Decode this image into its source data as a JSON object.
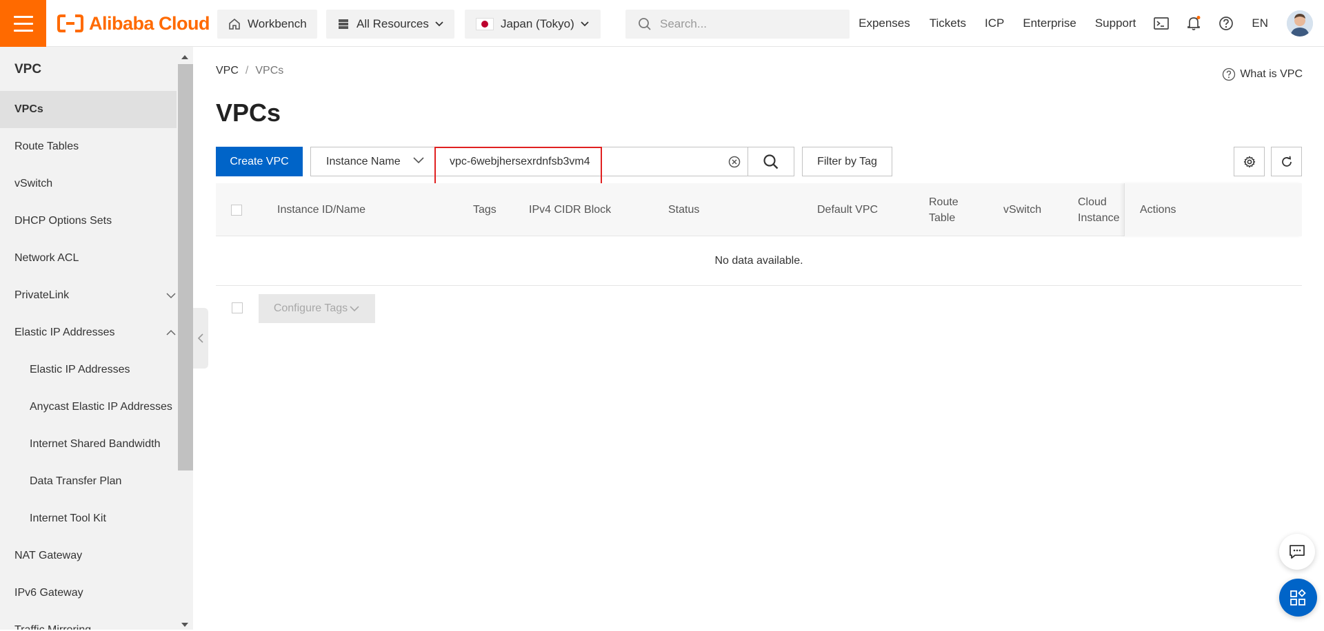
{
  "header": {
    "brand": "Alibaba Cloud",
    "workbench": "Workbench",
    "resources": "All Resources",
    "region": "Japan (Tokyo)",
    "search_placeholder": "Search...",
    "links": [
      "Expenses",
      "Tickets",
      "ICP",
      "Enterprise",
      "Support"
    ],
    "lang": "EN"
  },
  "sidebar": {
    "title": "VPC",
    "items": [
      {
        "label": "VPCs",
        "active": true
      },
      {
        "label": "Route Tables"
      },
      {
        "label": "vSwitch"
      },
      {
        "label": "DHCP Options Sets"
      },
      {
        "label": "Network ACL"
      },
      {
        "label": "PrivateLink",
        "expand": "down"
      },
      {
        "label": "Elastic IP Addresses",
        "expand": "up"
      },
      {
        "label": "Elastic IP Addresses",
        "sub": true
      },
      {
        "label": "Anycast Elastic IP Addresses",
        "sub": true
      },
      {
        "label": "Internet Shared Bandwidth",
        "sub": true
      },
      {
        "label": "Data Transfer Plan",
        "sub": true
      },
      {
        "label": "Internet Tool Kit",
        "sub": true
      },
      {
        "label": "NAT Gateway"
      },
      {
        "label": "IPv6 Gateway"
      },
      {
        "label": "Traffic Mirroring"
      }
    ]
  },
  "breadcrumb": {
    "root": "VPC",
    "sep": "/",
    "current": "VPCs"
  },
  "help": "What is VPC",
  "page_title": "VPCs",
  "toolbar": {
    "create": "Create VPC",
    "filter_field": "Instance Name",
    "search_value": "vpc-6webjhersexrdnfsb3vm4",
    "filter_by_tag": "Filter by Tag"
  },
  "table": {
    "columns": [
      {
        "label": "Instance ID/Name"
      },
      {
        "label": "Tags"
      },
      {
        "label": "IPv4 CIDR Block"
      },
      {
        "label": "Status"
      },
      {
        "label": "Default VPC"
      },
      {
        "label": "Route Table"
      },
      {
        "label": "vSwitch"
      },
      {
        "label": "Cloud Instance"
      },
      {
        "label": "Actions"
      }
    ],
    "empty": "No data available."
  },
  "footer": {
    "configure_tags": "Configure Tags"
  },
  "colors": {
    "brand": "#ff6a00",
    "primary": "#0064c8",
    "highlight": "#e02020"
  }
}
